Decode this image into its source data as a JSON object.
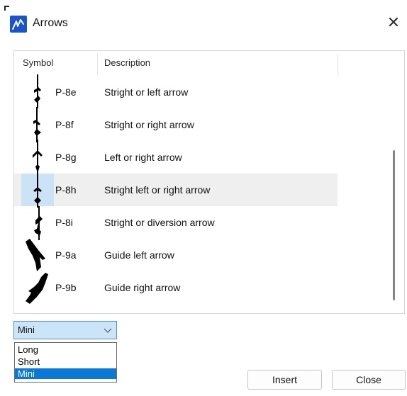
{
  "window": {
    "title": "Arrows",
    "icon": "app-arrow-icon",
    "close_icon": "close-icon",
    "accent": "#1b54c9"
  },
  "list": {
    "columns": [
      "Symbol",
      "Description"
    ],
    "rows": [
      {
        "code": "P-8e",
        "description": "Stright or left arrow",
        "icon": "arrow-symbol-p8e"
      },
      {
        "code": "P-8f",
        "description": "Stright or right arrow",
        "icon": "arrow-symbol-p8f"
      },
      {
        "code": "P-8g",
        "description": "Left or right arrow",
        "icon": "arrow-symbol-p8g"
      },
      {
        "code": "P-8h",
        "description": "Stright left or right arrow",
        "icon": "arrow-symbol-p8h",
        "selected": true
      },
      {
        "code": "P-8i",
        "description": "Stright or diversion arrow",
        "icon": "arrow-symbol-p8i"
      },
      {
        "code": "P-9a",
        "description": "Guide left arrow",
        "icon": "arrow-symbol-p9a"
      },
      {
        "code": "P-9b",
        "description": "Guide right arrow",
        "icon": "arrow-symbol-p9b"
      }
    ]
  },
  "size_select": {
    "value": "Mini",
    "options": [
      "Long",
      "Short",
      "Mini"
    ],
    "selected_option": "Mini",
    "selection_color": "#0a78d7"
  },
  "buttons": {
    "insert": "Insert",
    "close": "Close"
  }
}
